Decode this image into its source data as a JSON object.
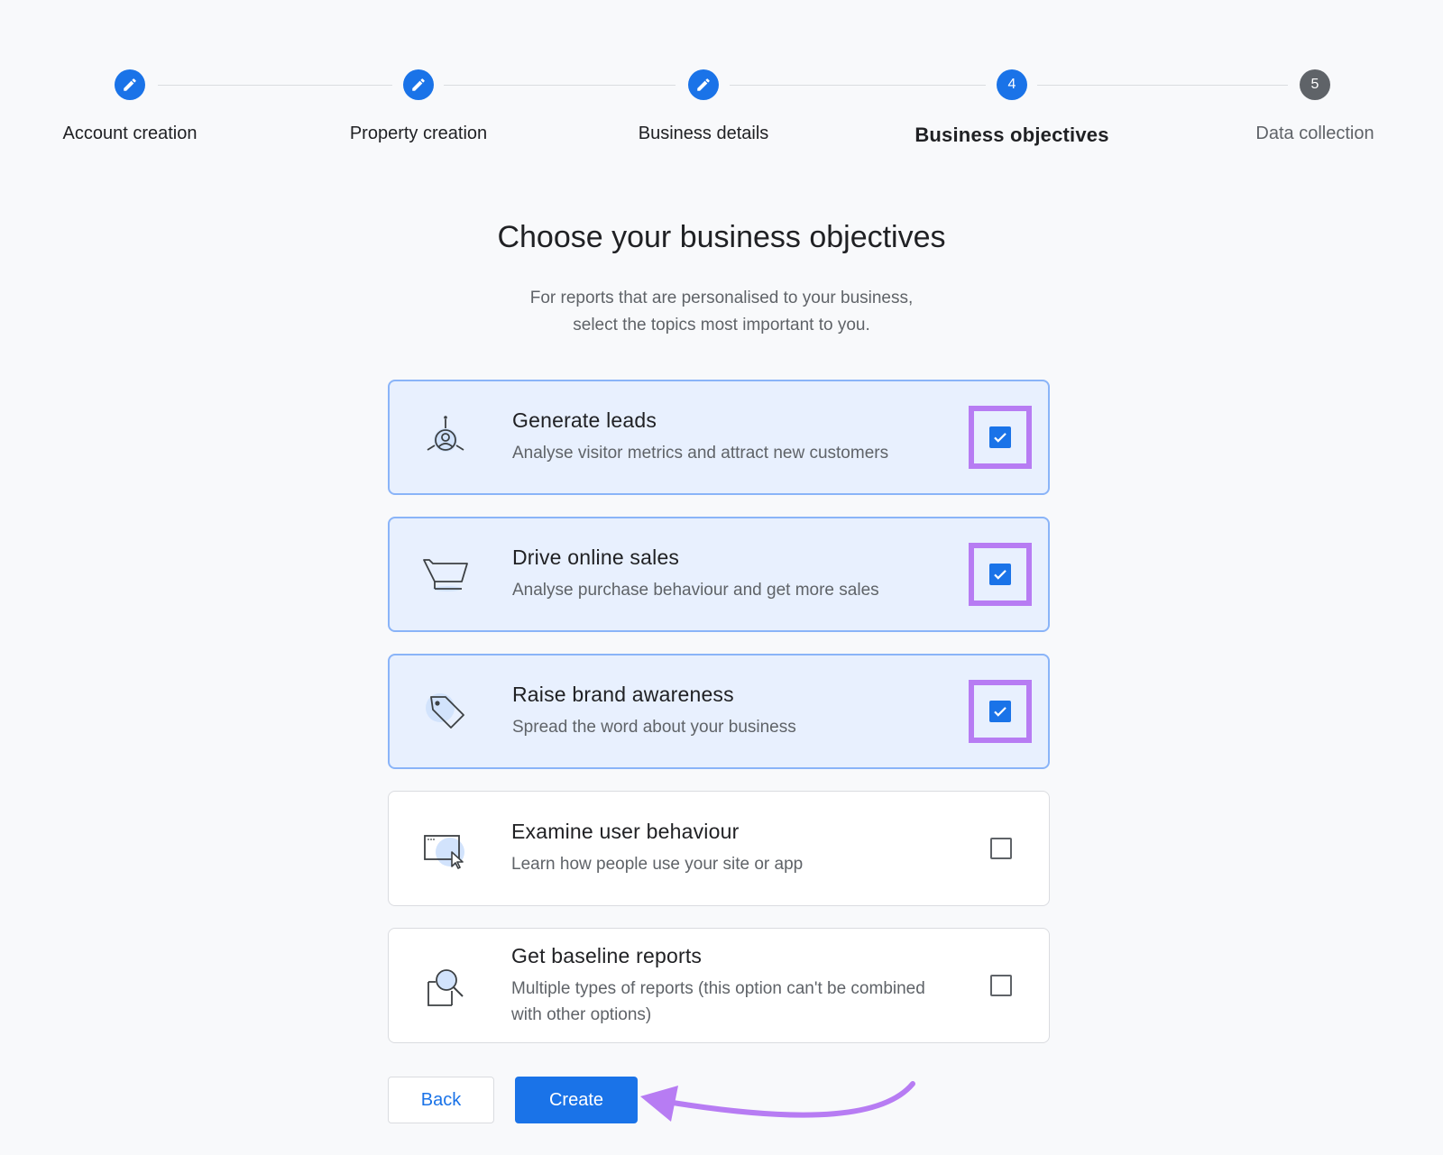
{
  "stepper": {
    "steps": [
      {
        "label": "Account creation",
        "state": "done",
        "icon": "edit-icon"
      },
      {
        "label": "Property creation",
        "state": "done",
        "icon": "edit-icon"
      },
      {
        "label": "Business details",
        "state": "done",
        "icon": "edit-icon"
      },
      {
        "label": "Business objectives",
        "state": "current",
        "number": "4"
      },
      {
        "label": "Data collection",
        "state": "pending",
        "number": "5"
      }
    ]
  },
  "page": {
    "title": "Choose your business objectives",
    "subtitle_line1": "For reports that are personalised to your business,",
    "subtitle_line2": "select the topics most important to you."
  },
  "options": [
    {
      "title": "Generate leads",
      "description": "Analyse visitor metrics and attract new customers",
      "checked": true,
      "icon": "leads-icon"
    },
    {
      "title": "Drive online sales",
      "description": "Analyse purchase behaviour and get more sales",
      "checked": true,
      "icon": "cart-icon"
    },
    {
      "title": "Raise brand awareness",
      "description": "Spread the word about your business",
      "checked": true,
      "icon": "tag-icon"
    },
    {
      "title": "Examine user behaviour",
      "description": "Learn how people use your site or app",
      "checked": false,
      "icon": "screen-cursor-icon"
    },
    {
      "title": "Get baseline reports",
      "description": "Multiple types of reports (this option can't be combined with other options)",
      "checked": false,
      "icon": "report-search-icon"
    }
  ],
  "buttons": {
    "back": "Back",
    "create": "Create"
  },
  "colors": {
    "primary": "#1a73e8",
    "selected_bg": "#e8f0fe",
    "highlight": "#b77cf3",
    "pending_step": "#5f6368"
  }
}
